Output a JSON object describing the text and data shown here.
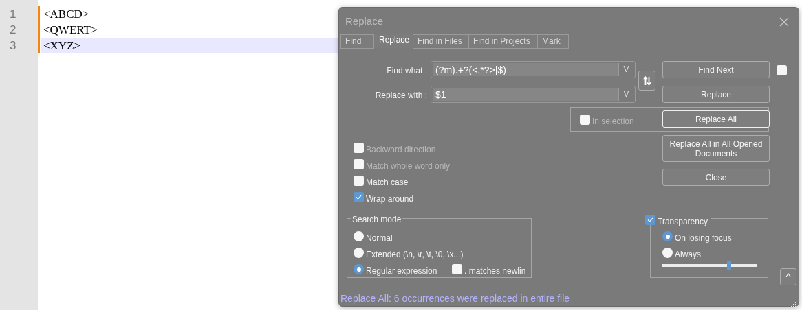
{
  "editor": {
    "lines": [
      {
        "number": "1",
        "text": "<ABCD>",
        "current": false
      },
      {
        "number": "2",
        "text": "<QWERT>",
        "current": false
      },
      {
        "number": "3",
        "text": "<XYZ>",
        "current": true
      }
    ]
  },
  "dialog": {
    "title": "Replace",
    "tabs": [
      {
        "label": "Find",
        "selected": false
      },
      {
        "label": "Replace",
        "selected": true
      },
      {
        "label": "Find in Files",
        "selected": false
      },
      {
        "label": "Find in Projects",
        "selected": false
      },
      {
        "label": "Mark",
        "selected": false
      }
    ],
    "find_what": {
      "label": "Find what :",
      "value": "(?m).+?(<.*?>|$)",
      "dropdown": "V"
    },
    "replace_with": {
      "label": "Replace with :",
      "value": "$1",
      "dropdown": "V"
    },
    "find_next": {
      "label": "Find Next"
    },
    "side_checkbox": {
      "checked": false
    },
    "replace": {
      "label": "Replace"
    },
    "in_selection": {
      "label": "In selection",
      "checked": false,
      "disabled": true
    },
    "replace_all": {
      "label": "Replace All",
      "default": true
    },
    "replace_all_opened": {
      "label": "Replace All in All Opened Documents"
    },
    "close": {
      "label": "Close"
    },
    "options": [
      {
        "label": "Backward direction",
        "checked": false,
        "disabled": true
      },
      {
        "label": "Match whole word only",
        "checked": false,
        "disabled": true
      },
      {
        "label": "Match case",
        "checked": false,
        "disabled": false
      },
      {
        "label": "Wrap around",
        "checked": true,
        "disabled": false
      }
    ],
    "search_mode": {
      "title": "Search mode",
      "modes": [
        {
          "label": "Normal",
          "selected": false
        },
        {
          "label": "Extended (\\n, \\r, \\t, \\0, \\x...)",
          "selected": false
        },
        {
          "label": "Regular expression",
          "selected": true
        }
      ],
      "dot_newline": {
        "label": ". matches newlin",
        "checked": false
      }
    },
    "transparency": {
      "label": "Transparency",
      "checked": true,
      "modes": [
        {
          "label": "On losing focus",
          "selected": true
        },
        {
          "label": "Always",
          "selected": false
        }
      ],
      "level": 0.71
    },
    "collapse": {
      "label": "^"
    },
    "status": "Replace All: 6 occurrences were replaced in entire file"
  }
}
